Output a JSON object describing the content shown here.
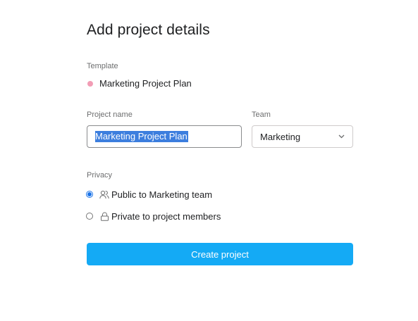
{
  "dialog": {
    "title": "Add project details"
  },
  "template": {
    "label": "Template",
    "name": "Marketing Project Plan",
    "dot_color": "#f29db5"
  },
  "project_name": {
    "label": "Project name",
    "value": "Marketing Project Plan"
  },
  "team": {
    "label": "Team",
    "selected": "Marketing",
    "icon": "chevron-down-icon"
  },
  "privacy": {
    "label": "Privacy",
    "options": [
      {
        "label": "Public to Marketing team",
        "icon": "people-icon",
        "checked": true
      },
      {
        "label": "Private to project members",
        "icon": "lock-icon",
        "checked": false
      }
    ]
  },
  "actions": {
    "create_label": "Create project",
    "create_color": "#14aaf5"
  }
}
